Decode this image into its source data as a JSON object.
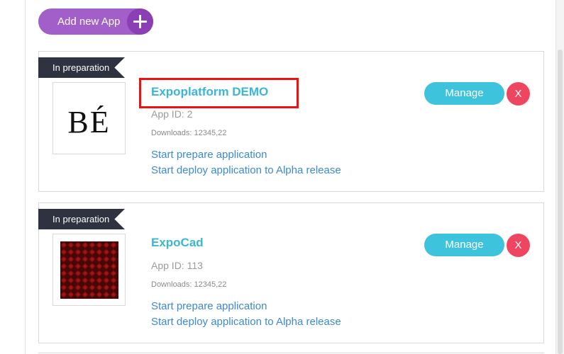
{
  "toolbar": {
    "add_label": "Add new App",
    "add_icon": "plus-icon"
  },
  "apps": [
    {
      "status": "In preparation",
      "title": "Expoplatform DEMO",
      "logo_text": "BÉ",
      "app_id": "App ID: 2",
      "downloads": "Downloads: 12345,22",
      "prepare_link": "Start prepare application",
      "deploy_link": "Start deploy application to Alpha release",
      "manage_label": "Manage",
      "delete_label": "X"
    },
    {
      "status": "In preparation",
      "title": "ExpoCad",
      "app_id": "App ID: 113",
      "downloads": "Downloads: 12345,22",
      "prepare_link": "Start prepare application",
      "deploy_link": "Start deploy application to Alpha release",
      "manage_label": "Manage",
      "delete_label": "X"
    }
  ],
  "colors": {
    "add_button": "#a25fc9",
    "add_button_plus": "#8a3fb5",
    "ribbon": "#2f3240",
    "title": "#3ab6d6",
    "link": "#3a8ad6",
    "manage_button": "#3ec3dc",
    "delete_button": "#ee4561",
    "highlight": "#ee1111"
  }
}
